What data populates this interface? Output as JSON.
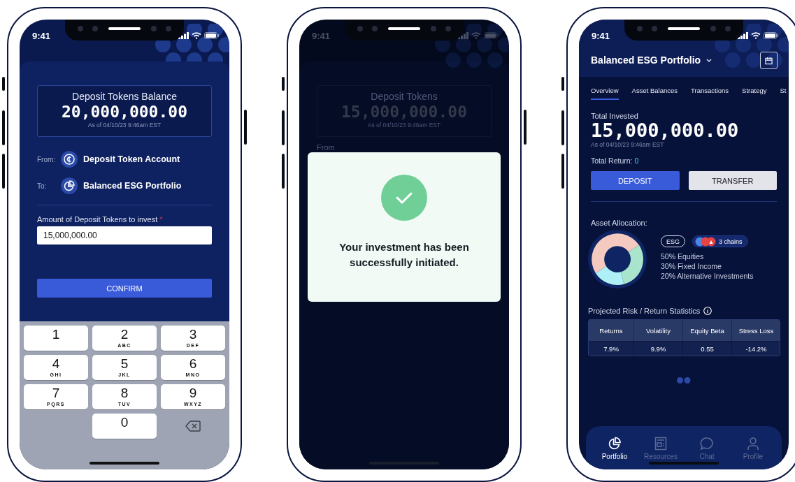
{
  "phones": [
    {
      "kind": "deposit",
      "status_time": "9:41",
      "balance": {
        "title": "Deposit Tokens Balance",
        "amount": "20,000,000.00",
        "timestamp": "As of 04/10/23 9:46am EST"
      },
      "transfer": [
        {
          "kind": "token",
          "label": "From:",
          "account": "Deposit Token Account"
        },
        {
          "kind": "portfolio",
          "label": "To:",
          "account": "Balanced ESG Portfolio"
        }
      ],
      "amount_field": {
        "label": "Amount of Deposit Tokens to invest",
        "required_mark": "*",
        "value": "15,000,000.00"
      },
      "confirm_button": "CONFIRM",
      "keypad": [
        {
          "kind": "digit",
          "digit": "1"
        },
        {
          "kind": "digit",
          "digit": "2",
          "letters": "ABC"
        },
        {
          "kind": "digit",
          "digit": "3",
          "letters": "DEF"
        },
        {
          "kind": "digit",
          "digit": "4",
          "letters": "GHI"
        },
        {
          "kind": "digit",
          "digit": "5",
          "letters": "JKL"
        },
        {
          "kind": "digit",
          "digit": "6",
          "letters": "MNO"
        },
        {
          "kind": "digit",
          "digit": "7",
          "letters": "PQRS"
        },
        {
          "kind": "digit",
          "digit": "8",
          "letters": "TUV"
        },
        {
          "kind": "digit",
          "digit": "9",
          "letters": "WXYZ"
        },
        {
          "kind": "blank"
        },
        {
          "kind": "digit",
          "digit": "0"
        },
        {
          "kind": "backspace"
        }
      ]
    },
    {
      "kind": "success",
      "status_time": "9:41",
      "background": {
        "title": "Deposit Tokens",
        "amount": "15,000,000.00",
        "timestamp": "As of 04/10/23 9:46am EST",
        "from_label": "From"
      },
      "dialog": {
        "message": "Your investment has been successfully initiated."
      }
    },
    {
      "kind": "portfolio",
      "status_time": "9:41",
      "title": "Balanced ESG Portfolio",
      "tabs": [
        {
          "label": "Overview",
          "selected": true
        },
        {
          "label": "Asset Balances",
          "selected": false
        },
        {
          "label": "Transactions",
          "selected": false
        },
        {
          "label": "Strategy",
          "selected": false
        },
        {
          "label": "St",
          "selected": false
        }
      ],
      "total": {
        "label": "Total Invested",
        "amount": "15,000,000.00",
        "timestamp": "As of 04/10/23 9:46am EST",
        "return_label": "Total Return:",
        "return_value": "0"
      },
      "buttons": [
        {
          "kind": "primary",
          "label": "DEPOSIT"
        },
        {
          "kind": "secondary",
          "label": "TRANSFER"
        }
      ],
      "allocation": {
        "title": "Asset Allocation:",
        "chart_data": {
          "type": "donut",
          "categories": [
            "Equities",
            "Fixed Income",
            "Alternative Investments"
          ],
          "values": [
            50,
            30,
            20
          ]
        },
        "tags": [
          {
            "kind": "outline",
            "label": "ESG"
          },
          {
            "kind": "chains",
            "label": "3 chains"
          }
        ],
        "legend": [
          "50%",
          "30%",
          "20%"
        ]
      },
      "statistics": {
        "title": "Projected Risk / Return Statistics",
        "columns": [
          "Returns",
          "Volatility",
          "Equity Beta",
          "Stress Loss"
        ],
        "rows": [
          [
            "7.9%",
            "9.9%",
            "0.55",
            "-14.2%"
          ]
        ]
      },
      "nav": [
        {
          "label": "Portfolio",
          "selected": true
        },
        {
          "label": "Resources",
          "selected": false
        },
        {
          "label": "Chat",
          "selected": false
        },
        {
          "label": "Profile",
          "selected": false
        }
      ]
    }
  ]
}
